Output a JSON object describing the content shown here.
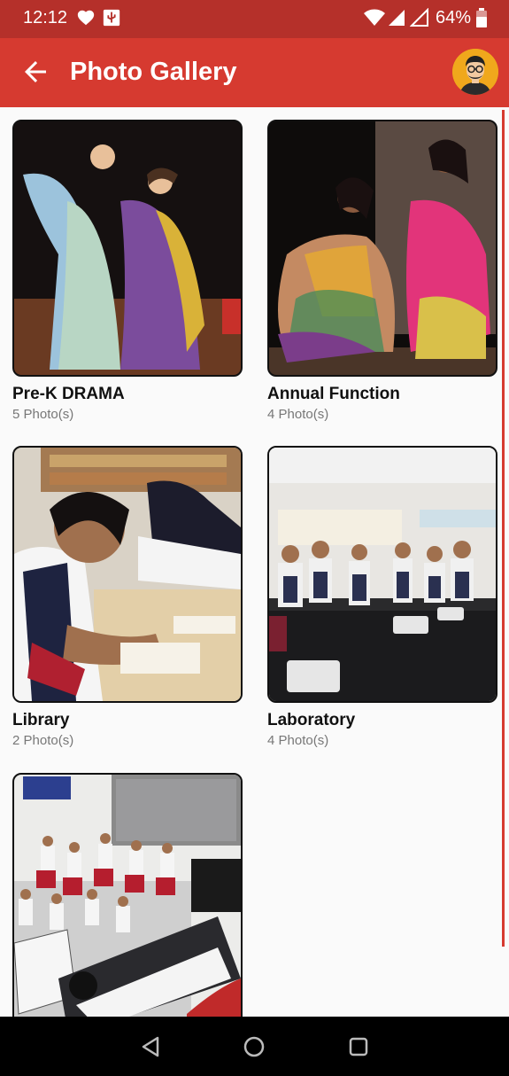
{
  "status_bar": {
    "time": "12:12",
    "battery": "64%"
  },
  "app_bar": {
    "title": "Photo Gallery"
  },
  "albums": [
    {
      "title": "Pre-K DRAMA",
      "count": "5 Photo(s)"
    },
    {
      "title": "Annual Function",
      "count": "4 Photo(s)"
    },
    {
      "title": "Library",
      "count": "2 Photo(s)"
    },
    {
      "title": "Laboratory",
      "count": "4 Photo(s)"
    },
    {
      "title": "",
      "count": ""
    }
  ],
  "colors": {
    "status_bar": "#b5302a",
    "app_bar": "#d63a30",
    "accent": "#d63a30"
  },
  "icons": [
    "heart-icon",
    "usb-icon",
    "wifi-icon",
    "signal-icon",
    "battery-icon",
    "back-arrow-icon",
    "profile-avatar-icon",
    "nav-back-icon",
    "nav-home-icon",
    "nav-recents-icon"
  ]
}
